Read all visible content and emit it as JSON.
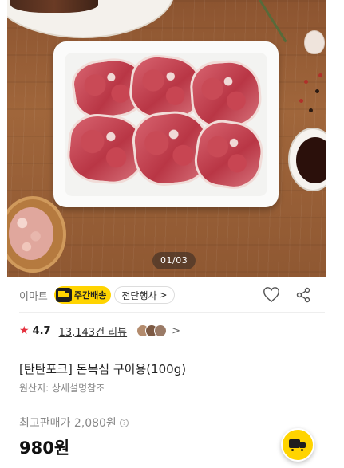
{
  "image": {
    "counter": "01/03"
  },
  "brand_row": {
    "brand": "이마트",
    "delivery_badge": "주간배송",
    "event_chip": "전단행사",
    "event_chevron": ">",
    "icons": [
      "heart-icon",
      "share-icon"
    ]
  },
  "rating": {
    "star": "★",
    "score": "4.7",
    "review_count": "13,143건 리뷰",
    "chevron": ">"
  },
  "product": {
    "name": "[탄탄포크] 돈목심 구이용(100g)",
    "origin": "원산지: 상세설명참조",
    "max_price": "최고판매가 2,080원",
    "help": "?",
    "price": "980원"
  },
  "colors": {
    "accent_yellow": "#ffd400",
    "star_red": "#e5323f"
  }
}
